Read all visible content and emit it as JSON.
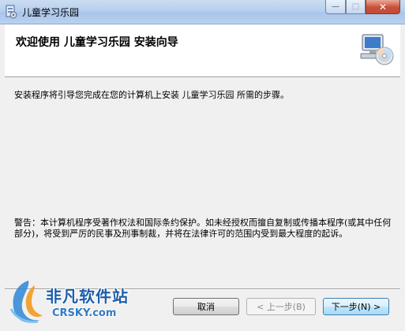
{
  "window": {
    "title": "儿童学习乐园",
    "app_icon": "installer-package-icon",
    "controls": {
      "minimize": "—",
      "maximize": "□",
      "close": "✕"
    }
  },
  "header": {
    "title": "欢迎使用 儿童学习乐园 安装向导",
    "graphic_icon": "computer-with-disc-icon"
  },
  "body": {
    "intro": "安装程序将引导您完成在您的计算机上安装 儿童学习乐园 所需的步骤。",
    "warning": "警告：本计算机程序受著作权法和国际条约保护。如未经授权而擅自复制或传播本程序(或其中任何部分)，将受到严厉的民事及刑事制裁，并将在法律许可的范围内受到最大程度的起诉。"
  },
  "buttons": {
    "cancel": "取消",
    "back": "< 上一步(B)",
    "next": "下一步(N) >"
  },
  "watermark": {
    "name_cn": "非凡软件站",
    "name_en": "CRSKY.com"
  },
  "colors": {
    "title_bar": "#b9d1ef",
    "close_button": "#c8503b",
    "default_button_border": "#3c7fb1",
    "watermark_blue": "#1d5ea8"
  }
}
